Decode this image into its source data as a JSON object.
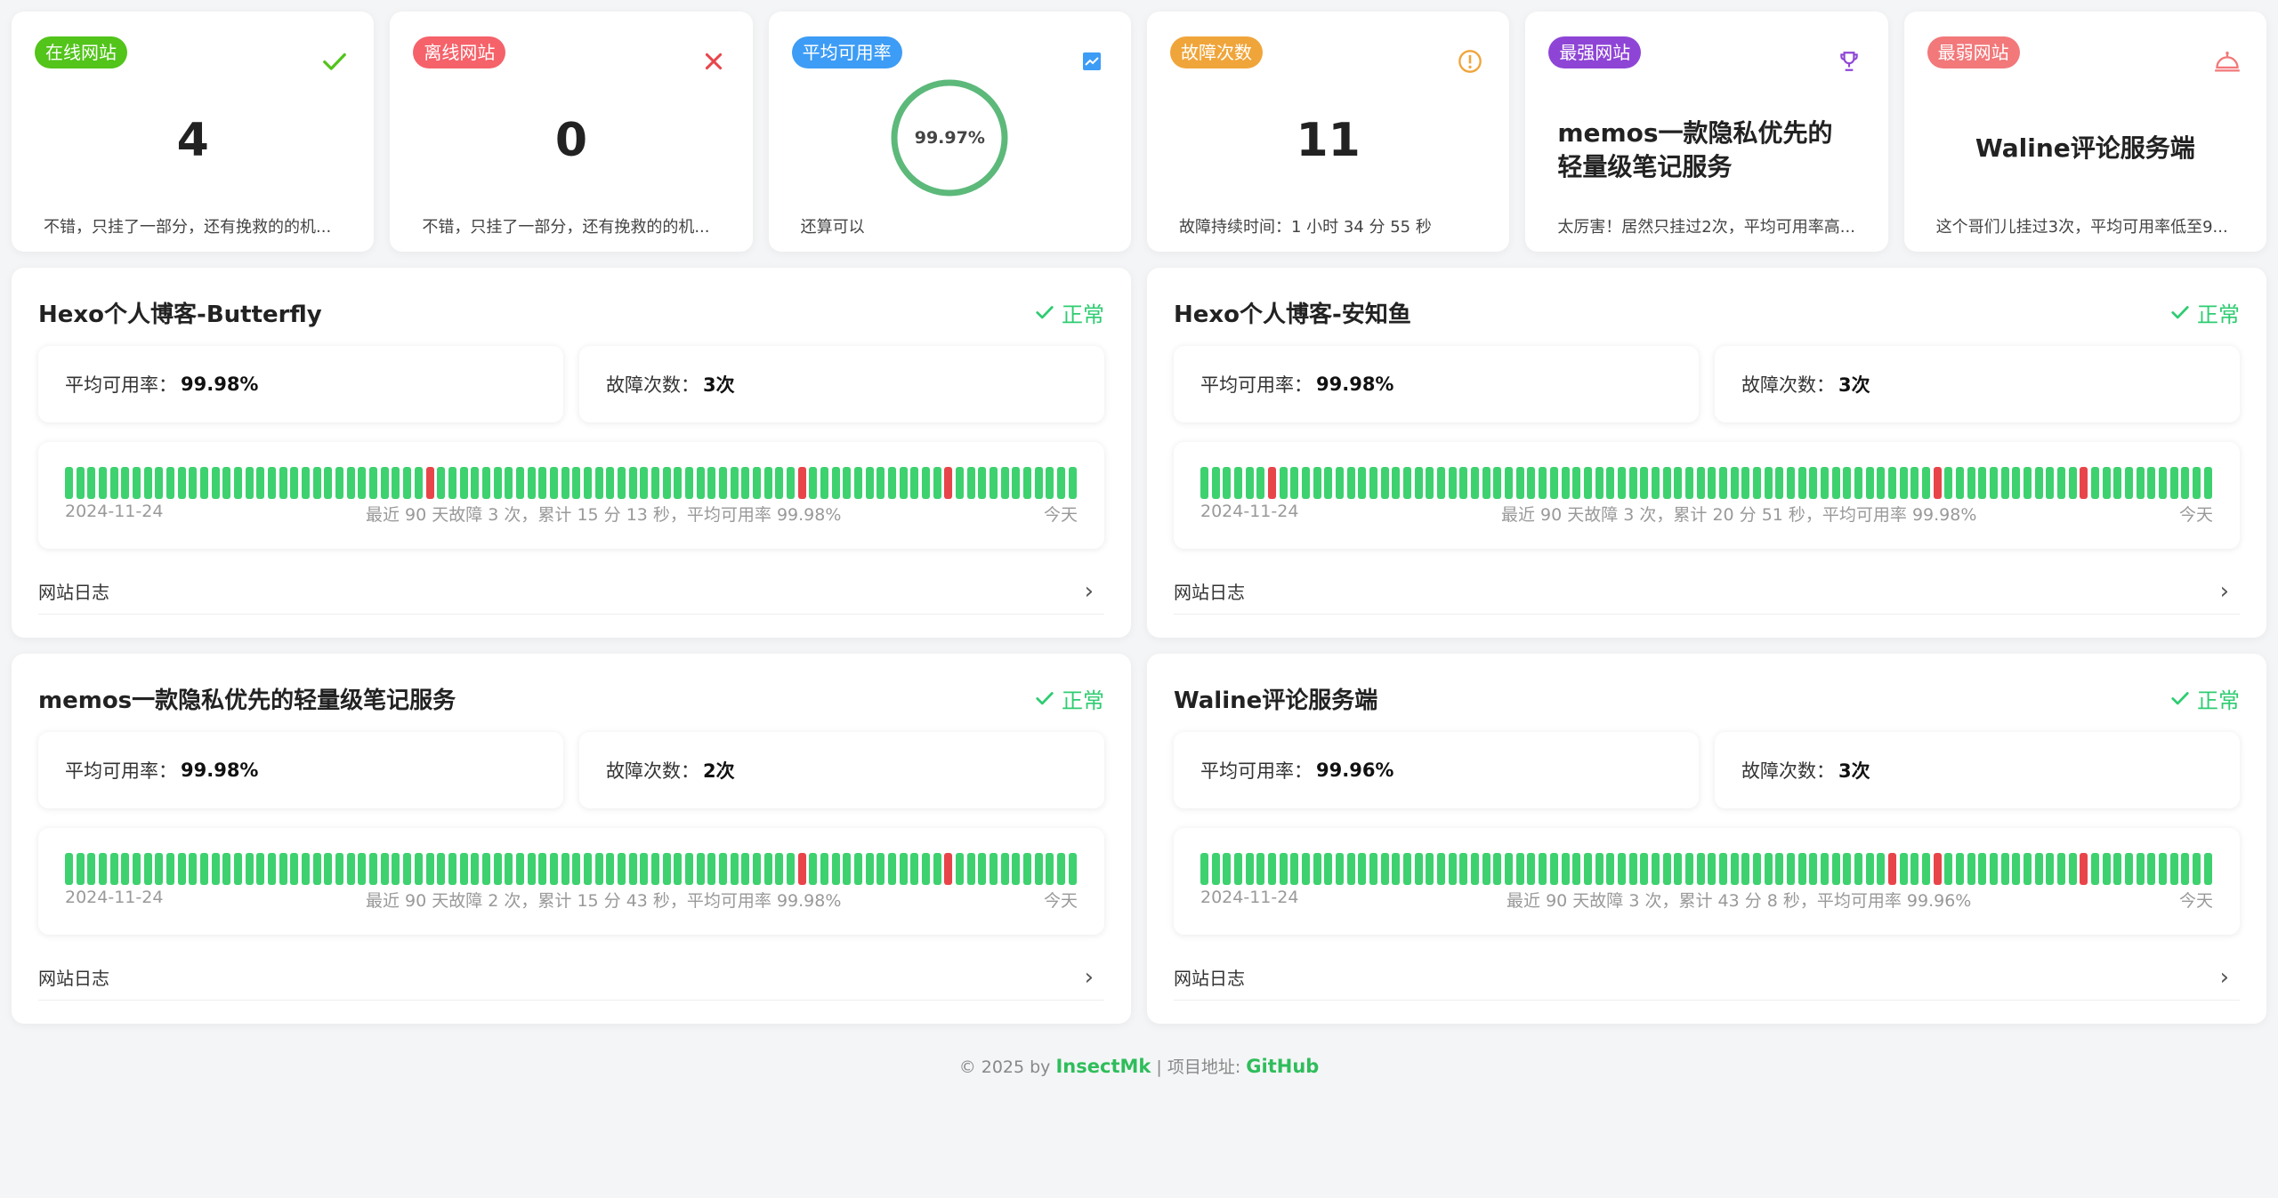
{
  "stats": [
    {
      "tag": "在线网站",
      "tag_color": "#52c41a",
      "icon": "check-icon",
      "value": "4",
      "desc": "不错，只挂了一部分，还有挽救的的机..."
    },
    {
      "tag": "离线网站",
      "tag_color": "#f5626a",
      "icon": "close-icon",
      "value": "0",
      "desc": "不错，只挂了一部分，还有挽救的的机..."
    },
    {
      "tag": "平均可用率",
      "tag_color": "#3d9cf5",
      "icon": "chart-icon",
      "value": "99.97%",
      "ring_fraction": 0.9997,
      "desc": "还算可以"
    },
    {
      "tag": "故障次数",
      "tag_color": "#f0a53a",
      "icon": "warning-icon",
      "value": "11",
      "desc": "故障持续时间：1 小时 34 分 55 秒"
    },
    {
      "tag": "最强网站",
      "tag_color": "#8e45d6",
      "icon": "trophy-icon",
      "title": "memos一款隐私优先的轻量级笔记服务",
      "desc": "太厉害！居然只挂过2次，平均可用率高..."
    },
    {
      "tag": "最弱网站",
      "tag_color": "#f2787a",
      "icon": "bell-icon",
      "title": "Waline评论服务端",
      "desc": "这个哥们儿挂过3次，平均可用率低至9..."
    }
  ],
  "common": {
    "status_label": "正常",
    "uptime_label": "平均可用率：",
    "fault_label": "故障次数：",
    "start_date": "2024-11-24",
    "today": "今天",
    "log_label": "网站日志"
  },
  "sites": [
    {
      "name": "Hexo个人博客-Butterfly",
      "uptime": "99.98%",
      "faults": "3次",
      "summary": "最近 90 天故障 3 次，累计 15 分 13 秒，平均可用率 99.98%",
      "bad_days": [
        32,
        65,
        78
      ]
    },
    {
      "name": "Hexo个人博客-安知鱼",
      "uptime": "99.98%",
      "faults": "3次",
      "summary": "最近 90 天故障 3 次，累计 20 分 51 秒，平均可用率 99.98%",
      "bad_days": [
        6,
        65,
        78
      ]
    },
    {
      "name": "memos一款隐私优先的轻量级笔记服务",
      "uptime": "99.98%",
      "faults": "2次",
      "summary": "最近 90 天故障 2 次，累计 15 分 43 秒，平均可用率 99.98%",
      "bad_days": [
        65,
        78
      ]
    },
    {
      "name": "Waline评论服务端",
      "uptime": "99.96%",
      "faults": "3次",
      "summary": "最近 90 天故障 3 次，累计 43 分 8 秒，平均可用率 99.96%",
      "bad_days": [
        61,
        65,
        78
      ]
    }
  ],
  "footer": {
    "copyright": "© 2025 by",
    "author": "InsectMk",
    "sep": "| 项目地址:",
    "repo": "GitHub"
  },
  "colors": {
    "ok": "#3ed16f",
    "bad": "#e8454a",
    "status": "#2ecc71"
  }
}
